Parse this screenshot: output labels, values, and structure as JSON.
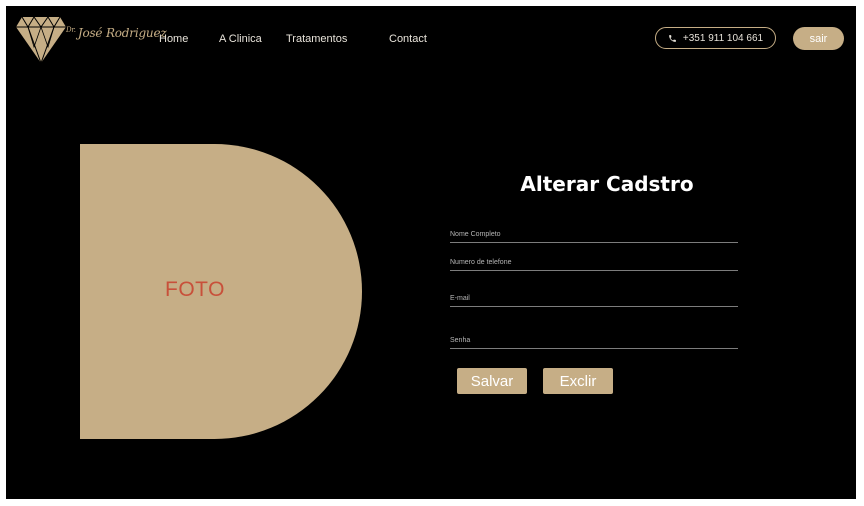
{
  "brand": {
    "prefix": "Dr.",
    "name": "José Rodriguez",
    "color": "#c6ae86"
  },
  "nav": {
    "items": [
      "Home",
      "A Clinica",
      "Tratamentos",
      "Contact"
    ]
  },
  "header": {
    "phone": "+351 911 104 661",
    "phone_icon": "phone-icon",
    "logout_label": "sair"
  },
  "photo": {
    "label": "FOTO",
    "label_color": "#c8503a"
  },
  "form": {
    "title": "Alterar Cadstro",
    "fields": [
      {
        "label": "Nome Completo"
      },
      {
        "label": "Numero de telefone"
      },
      {
        "label": "E-mail"
      },
      {
        "label": "Senha"
      }
    ],
    "save_label": "Salvar",
    "delete_label": "Exclir"
  },
  "colors": {
    "background": "#000000",
    "accent": "#c6ae86"
  }
}
